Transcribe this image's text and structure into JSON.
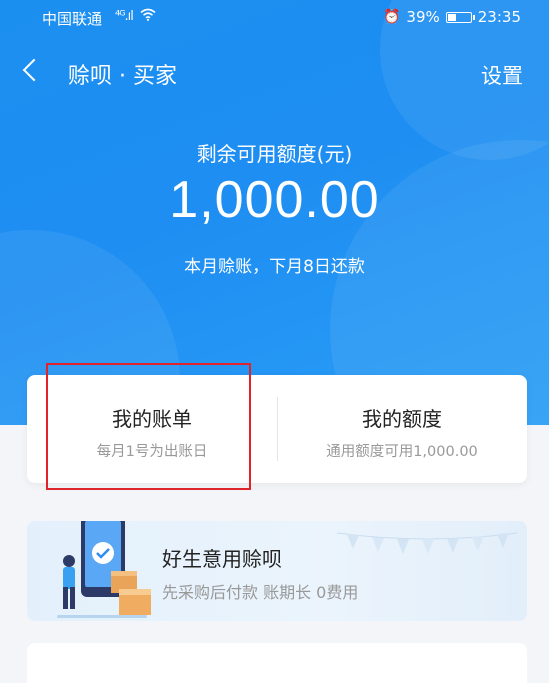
{
  "status_bar": {
    "carrier": "中国联通",
    "network": "⁴ᴳ.ıl",
    "alarm": "⏰",
    "battery_text": "39%",
    "battery_level": 0.39,
    "time": "23:35"
  },
  "nav": {
    "title": "赊呗 · 买家",
    "settings_label": "设置"
  },
  "hero": {
    "quota_label": "剩余可用额度(元)",
    "quota_amount": "1,000.00",
    "repay_note": "本月赊账，下月8日还款"
  },
  "summary_card": {
    "bill": {
      "title": "我的账单",
      "subtitle": "每月1号为出账日"
    },
    "quota": {
      "title": "我的额度",
      "subtitle": "通用额度可用1,000.00"
    }
  },
  "promo": {
    "title": "好生意用赊呗",
    "subtitle": "先采购后付款 账期长 0费用"
  },
  "colors": {
    "brand_blue": "#1e8ef2",
    "highlight_red": "#e0242c"
  }
}
